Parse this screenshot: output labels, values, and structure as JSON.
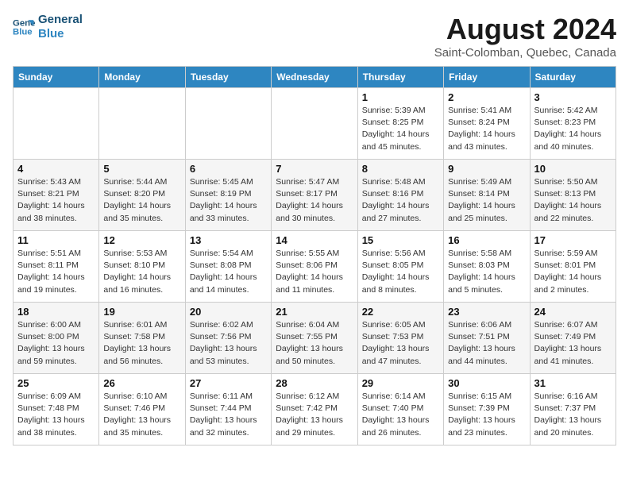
{
  "logo": {
    "line1": "General",
    "line2": "Blue"
  },
  "title": "August 2024",
  "subtitle": "Saint-Colomban, Quebec, Canada",
  "days_of_week": [
    "Sunday",
    "Monday",
    "Tuesday",
    "Wednesday",
    "Thursday",
    "Friday",
    "Saturday"
  ],
  "weeks": [
    [
      {
        "day": "",
        "info": ""
      },
      {
        "day": "",
        "info": ""
      },
      {
        "day": "",
        "info": ""
      },
      {
        "day": "",
        "info": ""
      },
      {
        "day": "1",
        "info": "Sunrise: 5:39 AM\nSunset: 8:25 PM\nDaylight: 14 hours and 45 minutes."
      },
      {
        "day": "2",
        "info": "Sunrise: 5:41 AM\nSunset: 8:24 PM\nDaylight: 14 hours and 43 minutes."
      },
      {
        "day": "3",
        "info": "Sunrise: 5:42 AM\nSunset: 8:23 PM\nDaylight: 14 hours and 40 minutes."
      }
    ],
    [
      {
        "day": "4",
        "info": "Sunrise: 5:43 AM\nSunset: 8:21 PM\nDaylight: 14 hours and 38 minutes."
      },
      {
        "day": "5",
        "info": "Sunrise: 5:44 AM\nSunset: 8:20 PM\nDaylight: 14 hours and 35 minutes."
      },
      {
        "day": "6",
        "info": "Sunrise: 5:45 AM\nSunset: 8:19 PM\nDaylight: 14 hours and 33 minutes."
      },
      {
        "day": "7",
        "info": "Sunrise: 5:47 AM\nSunset: 8:17 PM\nDaylight: 14 hours and 30 minutes."
      },
      {
        "day": "8",
        "info": "Sunrise: 5:48 AM\nSunset: 8:16 PM\nDaylight: 14 hours and 27 minutes."
      },
      {
        "day": "9",
        "info": "Sunrise: 5:49 AM\nSunset: 8:14 PM\nDaylight: 14 hours and 25 minutes."
      },
      {
        "day": "10",
        "info": "Sunrise: 5:50 AM\nSunset: 8:13 PM\nDaylight: 14 hours and 22 minutes."
      }
    ],
    [
      {
        "day": "11",
        "info": "Sunrise: 5:51 AM\nSunset: 8:11 PM\nDaylight: 14 hours and 19 minutes."
      },
      {
        "day": "12",
        "info": "Sunrise: 5:53 AM\nSunset: 8:10 PM\nDaylight: 14 hours and 16 minutes."
      },
      {
        "day": "13",
        "info": "Sunrise: 5:54 AM\nSunset: 8:08 PM\nDaylight: 14 hours and 14 minutes."
      },
      {
        "day": "14",
        "info": "Sunrise: 5:55 AM\nSunset: 8:06 PM\nDaylight: 14 hours and 11 minutes."
      },
      {
        "day": "15",
        "info": "Sunrise: 5:56 AM\nSunset: 8:05 PM\nDaylight: 14 hours and 8 minutes."
      },
      {
        "day": "16",
        "info": "Sunrise: 5:58 AM\nSunset: 8:03 PM\nDaylight: 14 hours and 5 minutes."
      },
      {
        "day": "17",
        "info": "Sunrise: 5:59 AM\nSunset: 8:01 PM\nDaylight: 14 hours and 2 minutes."
      }
    ],
    [
      {
        "day": "18",
        "info": "Sunrise: 6:00 AM\nSunset: 8:00 PM\nDaylight: 13 hours and 59 minutes."
      },
      {
        "day": "19",
        "info": "Sunrise: 6:01 AM\nSunset: 7:58 PM\nDaylight: 13 hours and 56 minutes."
      },
      {
        "day": "20",
        "info": "Sunrise: 6:02 AM\nSunset: 7:56 PM\nDaylight: 13 hours and 53 minutes."
      },
      {
        "day": "21",
        "info": "Sunrise: 6:04 AM\nSunset: 7:55 PM\nDaylight: 13 hours and 50 minutes."
      },
      {
        "day": "22",
        "info": "Sunrise: 6:05 AM\nSunset: 7:53 PM\nDaylight: 13 hours and 47 minutes."
      },
      {
        "day": "23",
        "info": "Sunrise: 6:06 AM\nSunset: 7:51 PM\nDaylight: 13 hours and 44 minutes."
      },
      {
        "day": "24",
        "info": "Sunrise: 6:07 AM\nSunset: 7:49 PM\nDaylight: 13 hours and 41 minutes."
      }
    ],
    [
      {
        "day": "25",
        "info": "Sunrise: 6:09 AM\nSunset: 7:48 PM\nDaylight: 13 hours and 38 minutes."
      },
      {
        "day": "26",
        "info": "Sunrise: 6:10 AM\nSunset: 7:46 PM\nDaylight: 13 hours and 35 minutes."
      },
      {
        "day": "27",
        "info": "Sunrise: 6:11 AM\nSunset: 7:44 PM\nDaylight: 13 hours and 32 minutes."
      },
      {
        "day": "28",
        "info": "Sunrise: 6:12 AM\nSunset: 7:42 PM\nDaylight: 13 hours and 29 minutes."
      },
      {
        "day": "29",
        "info": "Sunrise: 6:14 AM\nSunset: 7:40 PM\nDaylight: 13 hours and 26 minutes."
      },
      {
        "day": "30",
        "info": "Sunrise: 6:15 AM\nSunset: 7:39 PM\nDaylight: 13 hours and 23 minutes."
      },
      {
        "day": "31",
        "info": "Sunrise: 6:16 AM\nSunset: 7:37 PM\nDaylight: 13 hours and 20 minutes."
      }
    ]
  ]
}
